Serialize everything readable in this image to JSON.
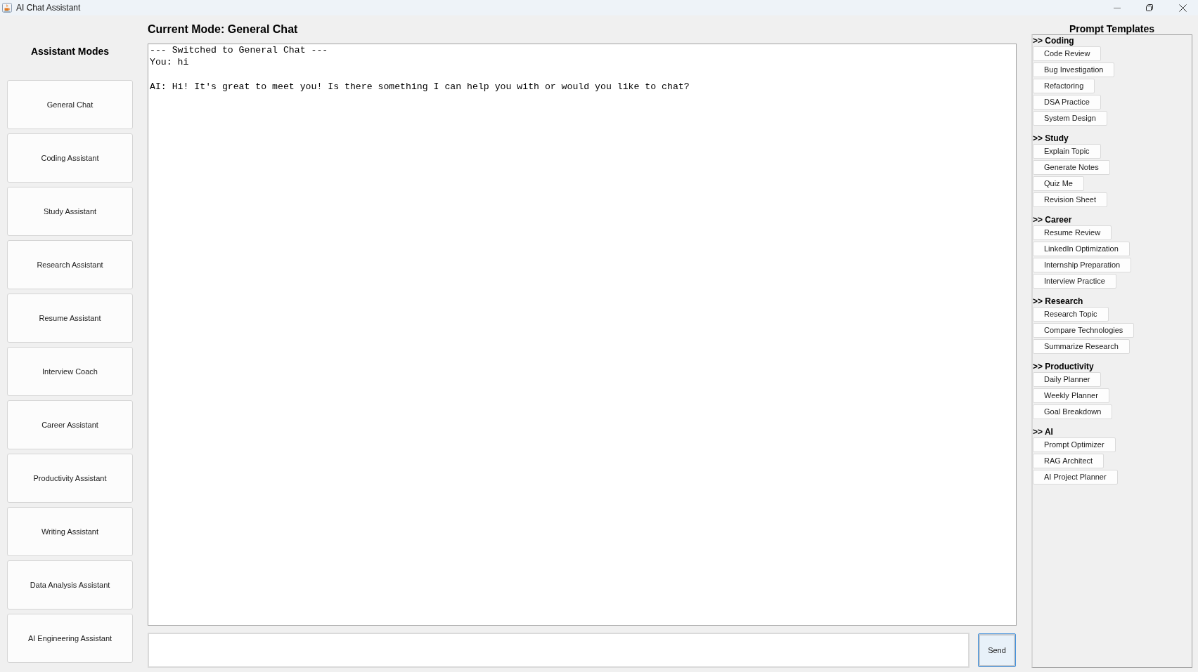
{
  "window": {
    "title": "AI Chat Assistant"
  },
  "sidebar": {
    "title": "Assistant Modes",
    "modes": [
      "General Chat",
      "Coding Assistant",
      "Study Assistant",
      "Research Assistant",
      "Resume Assistant",
      "Interview Coach",
      "Career Assistant",
      "Productivity Assistant",
      "Writing Assistant",
      "Data Analysis Assistant",
      "AI Engineering Assistant"
    ]
  },
  "chat": {
    "title": "Current Mode: General Chat",
    "messages": [
      {
        "kind": "system",
        "text": "--- Switched to General Chat ---"
      },
      {
        "kind": "user",
        "text": "You: hi"
      },
      {
        "kind": "ai",
        "text": "AI: Hi! It's great to meet you! Is there something I can help you with or would you like to chat?"
      }
    ],
    "send_button": {
      "label": "Send",
      "focused": true
    }
  },
  "templates": {
    "title": "Prompt Templates",
    "groups": [
      {
        "heading": ">> Coding",
        "items": [
          "Code Review",
          "Bug Investigation",
          "Refactoring",
          "DSA Practice",
          "System Design"
        ]
      },
      {
        "heading": ">> Study",
        "items": [
          "Explain Topic",
          "Generate Notes",
          "Quiz Me",
          "Revision Sheet"
        ]
      },
      {
        "heading": ">> Career",
        "items": [
          "Resume Review",
          "LinkedIn Optimization",
          "Internship Preparation",
          "Interview Practice"
        ]
      },
      {
        "heading": ">> Research",
        "items": [
          "Research Topic",
          "Compare Technologies",
          "Summarize Research"
        ]
      },
      {
        "heading": ">> Productivity",
        "items": [
          "Daily Planner",
          "Weekly Planner",
          "Goal Breakdown"
        ]
      },
      {
        "heading": ">> AI",
        "items": [
          "Prompt Optimizer",
          "RAG Architect",
          "AI Project Planner"
        ]
      }
    ]
  }
}
